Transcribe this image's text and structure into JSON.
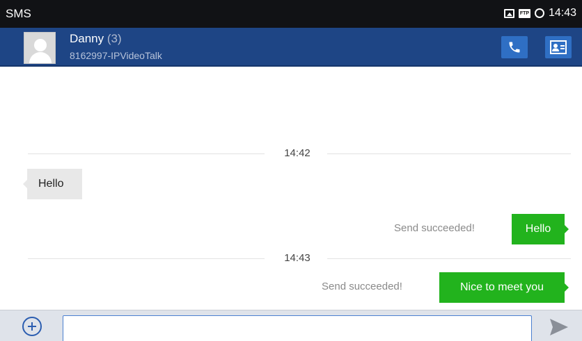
{
  "status_bar": {
    "app_name": "SMS",
    "time": "14:43",
    "ftp_label": "FTP",
    "icons": [
      "image-icon",
      "ftp-icon",
      "sync-ring-icon"
    ]
  },
  "header": {
    "contact_name": "Danny",
    "message_count": "(3)",
    "contact_number": "8162997-IPVideoTalk",
    "call_button_icon": "phone-icon",
    "contact_card_button_icon": "contact-card-icon",
    "bg_color": "#1e4585",
    "button_color": "#2f6fc4"
  },
  "thread": {
    "separators": [
      {
        "time": "14:42"
      },
      {
        "time": "14:43"
      }
    ],
    "messages": [
      {
        "direction": "incoming",
        "text": "Hello"
      },
      {
        "direction": "outgoing",
        "text": "Hello",
        "status": "Send succeeded!"
      },
      {
        "direction": "outgoing",
        "text": "Nice to meet you",
        "status": "Send succeeded!"
      }
    ],
    "incoming_bubble_color": "#e8e8e8",
    "outgoing_bubble_color": "#22b31d"
  },
  "compose": {
    "add_icon": "add-circle-icon",
    "input_value": "",
    "send_icon": "send-icon"
  }
}
